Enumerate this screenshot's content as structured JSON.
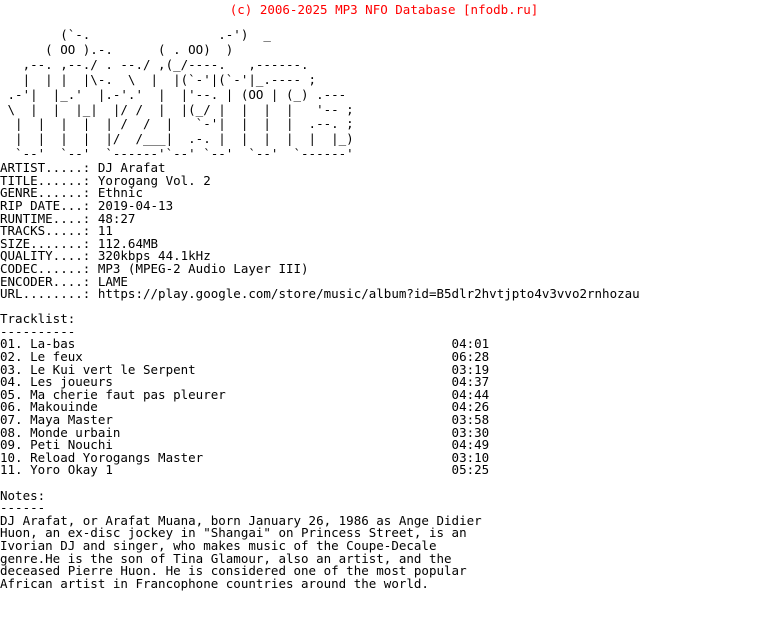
{
  "header": {
    "copyright": "(c) 2006-2025 MP3 NFO Database [nfodb.ru]",
    "copyright_color": "#ff0000"
  },
  "logo": {
    "alt": "nfodb ascii art logo",
    "lines": [
      "        (`-.                 .-')  _ ",
      "      ( OO ).-.      ( . OO)  ) ",
      "   ,--. ,--./ . --./ ,(_/----.   ,------. ",
      "   |  | |  |\\-.  \\  |  |(`-'|(`-'|_.---- ;",
      " .-'|  |_.'  |.-'.'  |  |'--. | (OO | (_) .--- ",
      " \\  |  |  |_|  |/ /  |  |(_/ |  |  |  |   '-- ;",
      "  |  |  |  |  | /  /  |   `-'|  |  |  |  .--. ;",
      "  |  |  |  |  |/  /___|  .-. |  |  |  |  |  |_)",
      "  `--'  `--'  `------'`--' `--'  `--'  `------' "
    ]
  },
  "fields": [
    {
      "label": "ARTIST.....:",
      "value": "DJ Arafat"
    },
    {
      "label": "TITLE......:",
      "value": "Yorogang Vol. 2"
    },
    {
      "label": "GENRE......:",
      "value": "Ethnic"
    },
    {
      "label": "RIP DATE...:",
      "value": "2019-04-13"
    },
    {
      "label": "RUNTIME....:",
      "value": "48:27"
    },
    {
      "label": "TRACKS.....:",
      "value": "11"
    },
    {
      "label": "SIZE.......:",
      "value": "112.64MB"
    },
    {
      "label": "QUALITY....:",
      "value": "320kbps 44.1kHz"
    },
    {
      "label": "CODEC......:",
      "value": "MP3 (MPEG-2 Audio Layer III)"
    },
    {
      "label": "ENCODER....:",
      "value": "LAME"
    },
    {
      "label": "URL........:",
      "value": "https://play.google.com/store/music/album?id=B5dlr2hvtjpto4v3vvo2rnhozau"
    }
  ],
  "tracklist": {
    "heading": "Tracklist:",
    "rule": "----------",
    "tracks": [
      {
        "num": "01.",
        "title": "La-bas",
        "duration": "04:01"
      },
      {
        "num": "02.",
        "title": "Le feux",
        "duration": "06:28"
      },
      {
        "num": "03.",
        "title": "Le Kui vert le Serpent",
        "duration": "03:19"
      },
      {
        "num": "04.",
        "title": "Les joueurs",
        "duration": "04:37"
      },
      {
        "num": "05.",
        "title": "Ma cherie faut pas pleurer",
        "duration": "04:44"
      },
      {
        "num": "06.",
        "title": "Makouinde",
        "duration": "04:26"
      },
      {
        "num": "07.",
        "title": "Maya Master",
        "duration": "03:58"
      },
      {
        "num": "08.",
        "title": "Monde urbain",
        "duration": "03:30"
      },
      {
        "num": "09.",
        "title": "Peti Nouchi",
        "duration": "04:49"
      },
      {
        "num": "10.",
        "title": "Reload Yorogangs Master",
        "duration": "03:10"
      },
      {
        "num": "11.",
        "title": "Yoro Okay 1",
        "duration": "05:25"
      }
    ]
  },
  "notes": {
    "heading": "Notes:",
    "rule": "------",
    "lines": [
      "DJ Arafat, or Arafat Muana, born January 26, 1986 as Ange Didier",
      "Huon, an ex-disc jockey in \"Shangai\" on Princess Street, is an",
      "Ivorian DJ and singer, who makes music of the Coupe-Decale",
      "genre.He is the son of Tina Glamour, also an artist, and the",
      "deceased Pierre Huon. He is considered one of the most popular",
      "African artist in Francophone countries around the world."
    ]
  }
}
